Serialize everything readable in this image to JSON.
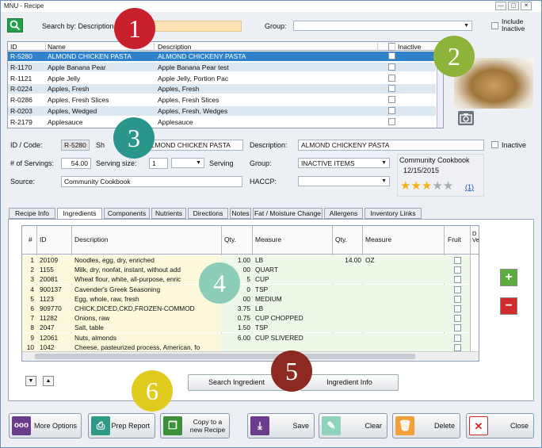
{
  "window": {
    "title": "MNU - Recipe",
    "min": "—",
    "max": "▢",
    "close": "✕"
  },
  "search": {
    "label": "Search by: Description",
    "value": "",
    "group_label": "Group:",
    "group_value": "",
    "include_inactive": "Include Inactive"
  },
  "list": {
    "headers": [
      "ID",
      "Name",
      "Description",
      "Inactive"
    ],
    "rows": [
      {
        "id": "R-5280",
        "name": "ALMOND CHICKEN PASTA",
        "desc": "ALMOND CHICKENY PASTA"
      },
      {
        "id": "R-1170",
        "name": "Apple Banana Pear",
        "desc": "Apple Banana Pear test"
      },
      {
        "id": "R-1121",
        "name": "Apple Jelly",
        "desc": "Apple Jelly, Portion Pac"
      },
      {
        "id": "R-0224",
        "name": "Apples, Fresh",
        "desc": "Apples, Fresh"
      },
      {
        "id": "R-0286",
        "name": "Apples, Fresh Slices",
        "desc": "Apples, Fresh Slices"
      },
      {
        "id": "R-0203",
        "name": "Apples, Wedged",
        "desc": "Apples, Fresh, Wedges"
      },
      {
        "id": "R-2179",
        "name": "Applesauce",
        "desc": "Applesauce"
      }
    ]
  },
  "detail": {
    "id_label": "ID / Code:",
    "id_value": "R-5280",
    "short_label": "Sh",
    "short_value": "ALMOND CHICKEN PASTA",
    "desc_label": "Description:",
    "desc_value": "ALMOND CHICKENY PASTA",
    "inactive_label": "Inactive",
    "servings_label": "# of Servings:",
    "servings_value": "54.00",
    "serving_size_label": "Serving size:",
    "serving_size_value": "1",
    "serving_unit": "Serving",
    "group_label": "Group:",
    "group_value": "INACTIVE ITEMS",
    "source_label": "Source:",
    "source_value": "Community Cookbook",
    "haccp_label": "HACCP:",
    "haccp_value": "",
    "rating_source": "Community Cookbook",
    "rating_date": "12/15/2015",
    "rating_stars": 3,
    "rating_count": "(1)"
  },
  "badges": [
    "1",
    "2",
    "3",
    "4",
    "5",
    "6"
  ],
  "badge_colors": {
    "red": "#c8202c",
    "green": "#8db43a",
    "teal": "#2a958a",
    "mint": "#8ccdb9",
    "maroon": "#8c2a22",
    "yellow": "#e0cc1e"
  },
  "tabs": [
    "Recipe Info",
    "Ingredients",
    "Components",
    "Nutrients",
    "Directions",
    "Notes",
    "Fat / Moisture Change",
    "Allergens",
    "Inventory Links"
  ],
  "grid": {
    "headers": {
      "num": "#",
      "id": "ID",
      "desc": "Description",
      "qty": "Qty.",
      "measure": "Measure",
      "qty2": "Qty.",
      "measure2": "Measure",
      "fruit": "Fruit",
      "extra": "D\nVe"
    },
    "rows": [
      {
        "n": "1",
        "id": "20109",
        "desc": "Noodles, egg, dry, enriched",
        "qty": "1.00",
        "measure": "LB",
        "qty2": "14.00",
        "measure2": "OZ"
      },
      {
        "n": "2",
        "id": "1155",
        "desc": "Milk, dry, nonfat, instant, without add",
        "qty": "00",
        "measure": "QUART",
        "qty2": "",
        "measure2": ""
      },
      {
        "n": "3",
        "id": "20081",
        "desc": "Wheat flour, white, all-purpose, enric",
        "qty": "5",
        "measure": "CUP",
        "qty2": "",
        "measure2": ""
      },
      {
        "n": "4",
        "id": "900137",
        "desc": "Cavender's Greek Seasoning",
        "qty": "0",
        "measure": "TSP",
        "qty2": "",
        "measure2": ""
      },
      {
        "n": "5",
        "id": "1123",
        "desc": "Egg, whole, raw, fresh",
        "qty": "00",
        "measure": "MEDIUM",
        "qty2": "",
        "measure2": ""
      },
      {
        "n": "6",
        "id": "909770",
        "desc": "CHICK,DICED,CKD,FROZEN-COMMOD",
        "qty": "3.75",
        "measure": "LB",
        "qty2": "",
        "measure2": ""
      },
      {
        "n": "7",
        "id": "11282",
        "desc": "Onions, raw",
        "qty": "0.75",
        "measure": "CUP CHOPPED",
        "qty2": "",
        "measure2": ""
      },
      {
        "n": "8",
        "id": "2047",
        "desc": "Salt, table",
        "qty": "1.50",
        "measure": "TSP",
        "qty2": "",
        "measure2": ""
      },
      {
        "n": "9",
        "id": "12061",
        "desc": "Nuts, almonds",
        "qty": "6.00",
        "measure": "CUP SLIVERED",
        "qty2": "",
        "measure2": ""
      },
      {
        "n": "10",
        "id": "1042",
        "desc": "Cheese, pasteurized process, American, fo",
        "qty": "",
        "measure": "",
        "qty2": "",
        "measure2": ""
      }
    ]
  },
  "buttons": {
    "search_ingredient": "Search Ingredient",
    "ingredient_info": "Ingredient Info",
    "more_options": "More Options",
    "prep_report": "Prep Report",
    "copy_recipe": "Copy to a new Recipe",
    "save": "Save",
    "clear": "Clear",
    "delete": "Delete",
    "close": "Close",
    "add": "+",
    "remove": "−"
  }
}
